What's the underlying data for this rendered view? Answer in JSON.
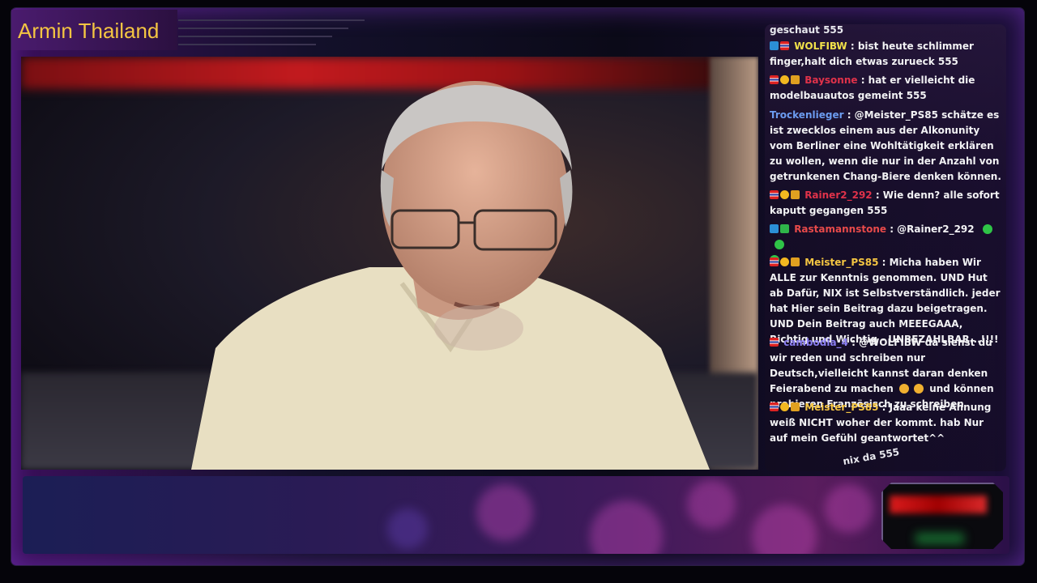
{
  "channel": {
    "title": "Armin Thailand"
  },
  "chat": {
    "top_fragment": "geschaut 555",
    "messages": [
      {
        "user": "WOLFIBW",
        "text": ": bist heute schlimmer finger,halt dich etwas zurueck 555"
      },
      {
        "user": "Baysonne",
        "text": ": hat er vielleicht die modelbauautos gemeint 555"
      },
      {
        "user": "Trockenlieger",
        "text": ": @Meister_PS85 schätze es ist zwecklos einem aus der Alkonunity vom Berliner eine Wohltätigkeit erklären zu wollen, wenn die nur in der Anzahl von getrunkenen Chang-Biere denken können."
      },
      {
        "user": "Rainer2_292",
        "text": ": Wie denn? alle sofort kaputt gegangen 555"
      },
      {
        "user": "Rastamannstone",
        "text": ": @Rainer2_292"
      },
      {
        "user": "Meister_PS85",
        "text": ": Micha haben Wir ALLE zur Kenntnis genommen. UND Hut ab Dafür, NIX ist Selbstverständlich. jeder hat Hier sein Beitrag dazu beigetragen. UND Dein Beitrag auch MEEEGAAA, Richtig und Wichtig - UNBEZAHLBAR...!!!!"
      },
      {
        "user": "cambodia_4",
        "text_a": ": @WOLFIBW da siehst du wir reden und schreiben nur Deutsch,vielleicht kannst daran denken Feierabend zu machen",
        "text_b": "und können probieren Französisch zu schreiben"
      },
      {
        "user": "Meister_PS85",
        "text": ": Jaaa keine Ahnung weiß NICHT woher der kommt. hab Nur auf mein Gefühl geantwortet^^"
      }
    ],
    "bottom_fragment": "nix da 555"
  },
  "icons": {
    "flag": "thailand-flag-icon",
    "badge": "subscriber-badge-icon",
    "emote": "emote-icon"
  },
  "colors": {
    "title": "#f4c542",
    "frame": "#3a0f5a",
    "chat_bg": "#281838"
  }
}
